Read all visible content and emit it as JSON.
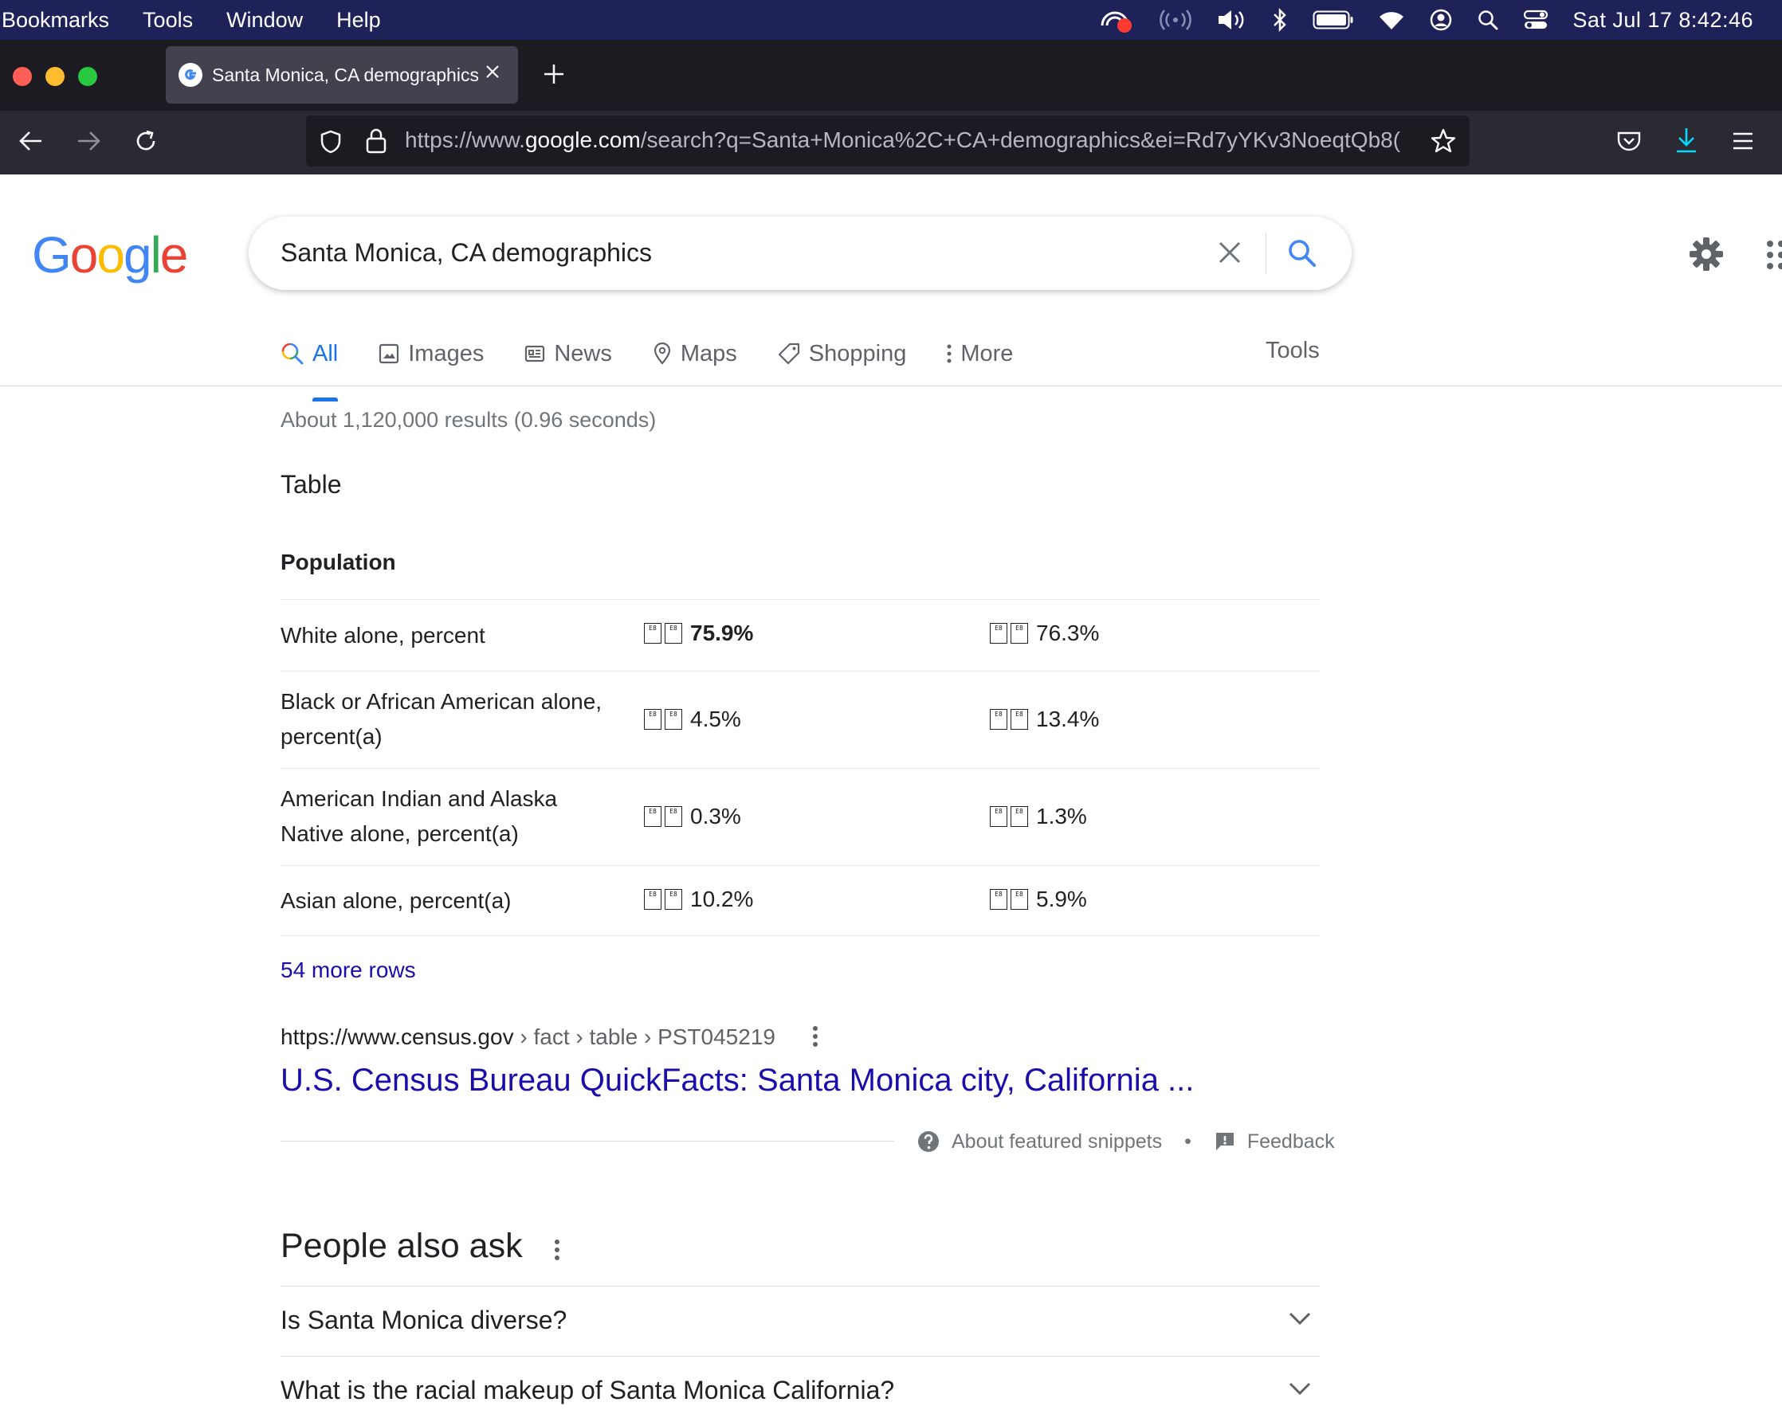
{
  "menubar": {
    "items": [
      "Bookmarks",
      "Tools",
      "Window",
      "Help"
    ],
    "clock": "Sat Jul 17  8:42:46"
  },
  "browser": {
    "tab_title": "Santa Monica, CA demographics",
    "url_scheme": "https://www.",
    "url_host": "google.com",
    "url_path": "/search?q=Santa+Monica%2C+CA+demographics&ei=Rd7yYKv3NoeqtQb8("
  },
  "google": {
    "logo_letters": [
      "G",
      "o",
      "o",
      "g",
      "l",
      "e"
    ],
    "logo_colors": [
      "#4285F4",
      "#EA4335",
      "#FBBC05",
      "#4285F4",
      "#34A853",
      "#EA4335"
    ],
    "search_value": "Santa Monica, CA demographics",
    "tabs": [
      "All",
      "Images",
      "News",
      "Maps",
      "Shopping",
      "More"
    ],
    "tools": "Tools",
    "result_stats": "About 1,120,000 results (0.96 seconds)"
  },
  "snippet": {
    "title": "Table",
    "header": "Population",
    "rows": [
      {
        "label_lines": [
          "White alone, percent"
        ],
        "v1": "75.9%",
        "v2": "76.3%"
      },
      {
        "label_lines": [
          "Black or African American alone,",
          "percent(a)"
        ],
        "v1": "4.5%",
        "v2": "13.4%"
      },
      {
        "label_lines": [
          "American Indian and Alaska",
          "Native alone, percent(a)"
        ],
        "v1": "0.3%",
        "v2": "1.3%"
      },
      {
        "label_lines": [
          "Asian alone, percent(a)"
        ],
        "v1": "10.2%",
        "v2": "5.9%"
      }
    ],
    "glyph_a": [
      "E8",
      "40"
    ],
    "glyph_b": [
      "E8",
      "3F"
    ],
    "more_rows": "54 more rows",
    "cite_domain": "https://www.census.gov",
    "cite_path": " › fact › table › PST045219",
    "result_title": "U.S. Census Bureau QuickFacts: Santa Monica city, California ...",
    "about_snippets": "About featured snippets",
    "separator": "•",
    "feedback": "Feedback"
  },
  "people_also_ask": {
    "title": "People also ask",
    "questions": [
      "Is Santa Monica diverse?",
      "What is the racial makeup of Santa Monica California?"
    ]
  }
}
